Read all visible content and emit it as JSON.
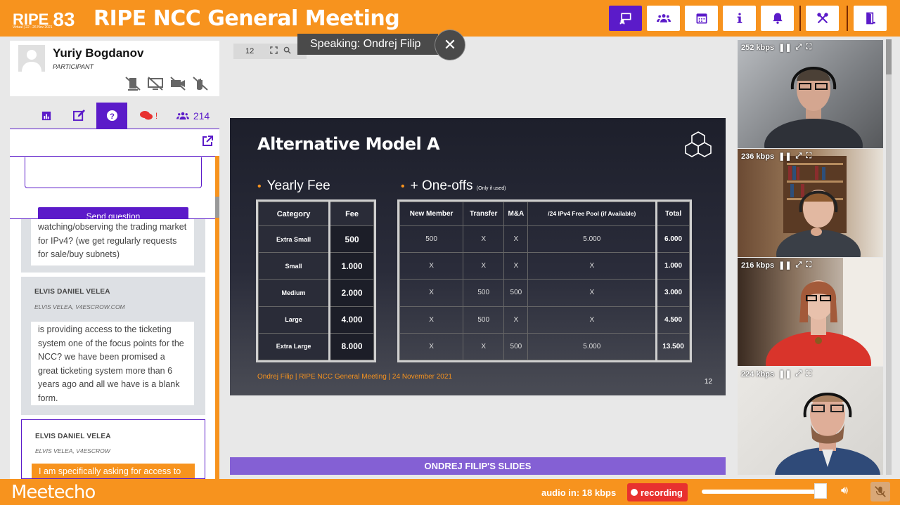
{
  "header": {
    "logo": "RIPE",
    "logo_number": "83",
    "logo_sub": "Virtual | 22 - 26 Nov 2021",
    "title": "RIPE NCC General Meeting"
  },
  "toolbar": {
    "icons": [
      "presentation-icon",
      "users-icon",
      "calendar-icon",
      "info-icon",
      "bell-icon",
      "tools-icon",
      "exit-icon"
    ]
  },
  "user": {
    "name": "Yuriy Bogdanov",
    "role": "PARTICIPANT",
    "status_icons": [
      "mic-off-icon",
      "screen-off-icon",
      "camera-off-icon",
      "hand-off-icon"
    ]
  },
  "tabs": {
    "participants_count": "214",
    "chat_badge": "!"
  },
  "qa": {
    "send_label": "Send question",
    "messages": [
      {
        "text": "watching/observing the trading market for IPv4? (we get regularly requests for sale/buy subnets)"
      },
      {
        "author": "ELVIS DANIEL VELEA",
        "org": "ELVIS VELEA, V4ESCROW.COM",
        "text": "is providing access to the ticketing system one of the focus points for the NCC? we have been promised a great ticketing system more than 6 years ago and all we have is a blank form."
      },
      {
        "author": "ELVIS DANIEL VELEA",
        "org": "ELVIS VELEA, V4ESCROW",
        "text": "I am specifically asking for access to"
      }
    ]
  },
  "presenter": {
    "slide_number": "12",
    "speaking": "Speaking: Ondrej Filip",
    "slides_label": "ONDREJ FILIP'S SLIDES"
  },
  "slide": {
    "title": "Alternative Model A",
    "yearly_heading": "Yearly Fee",
    "oneoffs_heading": "+ One-offs",
    "oneoffs_note": "(Only if used)",
    "fee_headers": [
      "Category",
      "Fee"
    ],
    "fee_rows": [
      [
        "Extra Small",
        "500"
      ],
      [
        "Small",
        "1.000"
      ],
      [
        "Medium",
        "2.000"
      ],
      [
        "Large",
        "4.000"
      ],
      [
        "Extra Large",
        "8.000"
      ]
    ],
    "oneoff_headers": [
      "New Member",
      "Transfer",
      "M&A",
      "/24 IPv4 Free Pool (if Available)",
      "Total"
    ],
    "oneoff_rows": [
      [
        "500",
        "X",
        "X",
        "5.000",
        "6.000"
      ],
      [
        "X",
        "X",
        "X",
        "X",
        "1.000"
      ],
      [
        "X",
        "500",
        "500",
        "X",
        "3.000"
      ],
      [
        "X",
        "500",
        "X",
        "X",
        "4.500"
      ],
      [
        "X",
        "X",
        "500",
        "5.000",
        "13.500"
      ]
    ],
    "footer": "Ondrej Filip | RIPE NCC General Meeting | 24 November 2021",
    "page": "12"
  },
  "videos": [
    {
      "kbps": "252",
      "unit": "kbps"
    },
    {
      "kbps": "236",
      "unit": "kbps"
    },
    {
      "kbps": "216",
      "unit": "kbps"
    },
    {
      "kbps": "224",
      "unit": "kbps"
    }
  ],
  "footer": {
    "brand": "Meetecho",
    "audio": "audio in: 18 kbps",
    "recording": "recording",
    "volume_level": 0.97
  },
  "colors": {
    "orange": "#f7931e",
    "purple": "#5b1bc9"
  }
}
